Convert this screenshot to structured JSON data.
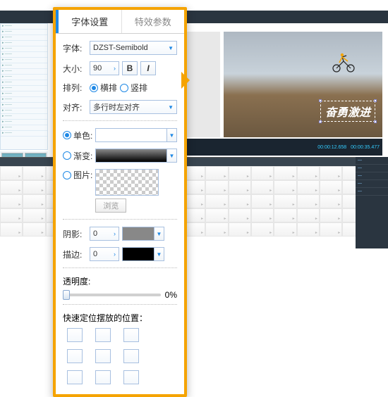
{
  "tabs": {
    "font": "字体设置",
    "fx": "特效参数"
  },
  "labels": {
    "font": "字体:",
    "size": "大小:",
    "arrange": "排列:",
    "align": "对齐:",
    "solid": "单色:",
    "gradient": "渐变:",
    "image": "图片:",
    "browse": "浏览",
    "shadow": "阴影:",
    "stroke": "描边:",
    "opacity": "透明度:",
    "quickpos": "快速定位摆放的位置："
  },
  "values": {
    "fontName": "DZST-Semibold",
    "size": "90",
    "horiz": "横排",
    "vert": "竖排",
    "alignMode": "多行时左对齐",
    "shadow": "0",
    "stroke": "0",
    "opacity": "0%"
  },
  "preview": {
    "overlayText": "奋勇激进"
  },
  "timecode": {
    "a": "00:00:12.658",
    "b": "00:00:35.477"
  },
  "chart_data": null
}
